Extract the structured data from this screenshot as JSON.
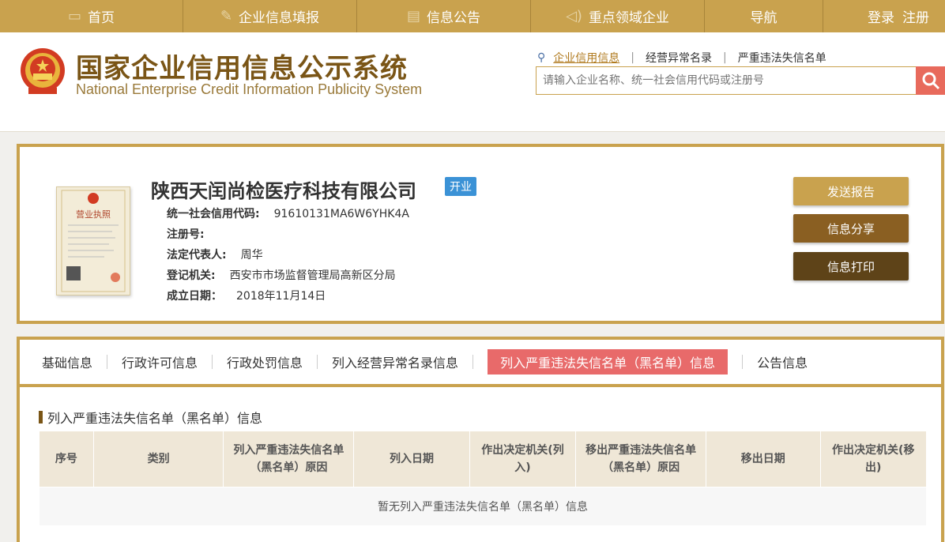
{
  "topnav": {
    "items": [
      {
        "icon": "monitor-icon",
        "label": "首页"
      },
      {
        "icon": "edit-icon",
        "label": "企业信息填报"
      },
      {
        "icon": "document-icon",
        "label": "信息公告"
      },
      {
        "icon": "megaphone-icon",
        "label": "重点领域企业"
      },
      {
        "icon": "",
        "label": "导航"
      }
    ],
    "login": "登录",
    "register": "注册"
  },
  "header": {
    "title_cn": "国家企业信用信息公示系统",
    "title_en": "National Enterprise Credit Information Publicity System",
    "search_links": [
      "企业信用信息",
      "经营异常名录",
      "严重违法失信名单"
    ],
    "search_placeholder": "请输入企业名称、统一社会信用代码或注册号"
  },
  "company": {
    "name": "陕西天闰尚检医疗科技有限公司",
    "status": "开业",
    "license_label": "营业执照",
    "fields": [
      {
        "label": "统一社会信用代码:",
        "value": "91610131MA6W6YHK4A"
      },
      {
        "label": "注册号:",
        "value": ""
      },
      {
        "label": "法定代表人:",
        "value": "周华"
      },
      {
        "label": "登记机关:",
        "value": "西安市市场监督管理局高新区分局"
      },
      {
        "label": "成立日期：",
        "value": "2018年11月14日"
      }
    ],
    "buttons": [
      "发送报告",
      "信息分享",
      "信息打印"
    ]
  },
  "tabs": [
    "基础信息",
    "行政许可信息",
    "行政处罚信息",
    "列入经营异常名录信息",
    "列入严重违法失信名单（黑名单）信息",
    "公告信息"
  ],
  "section": {
    "title": "列入严重违法失信名单（黑名单）信息",
    "columns": [
      "序号",
      "类别",
      "列入严重违法失信名单（黑名单）原因",
      "列入日期",
      "作出决定机关(列入)",
      "移出严重违法失信名单（黑名单）原因",
      "移出日期",
      "作出决定机关(移出)"
    ],
    "empty": "暂无列入严重违法失信名单（黑名单）信息"
  },
  "colors": {
    "gold": "#c9a24e",
    "brown": "#7a5516",
    "red": "#e86a6a",
    "blue": "#3b92d6"
  }
}
